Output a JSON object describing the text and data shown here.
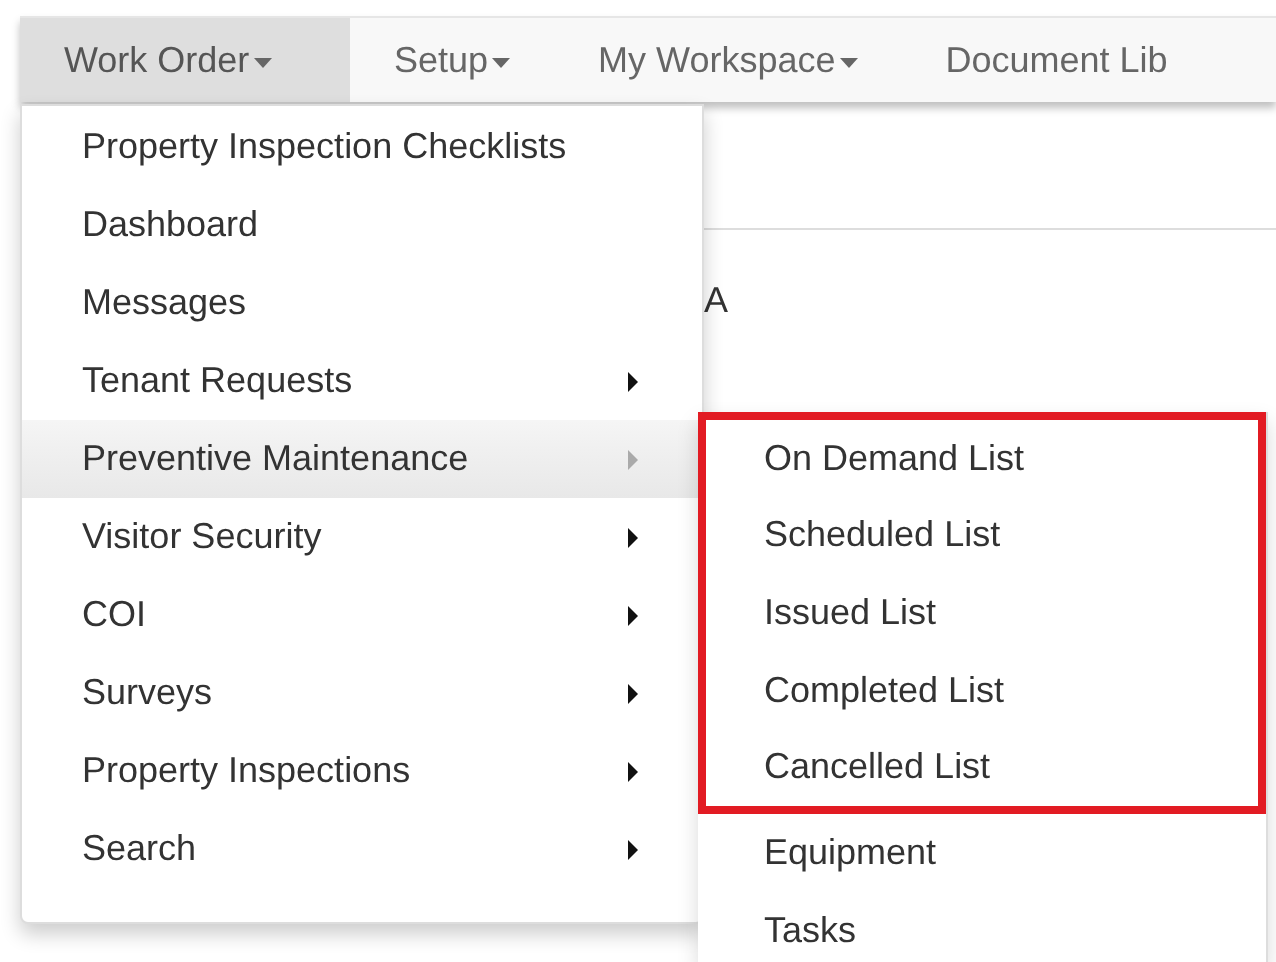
{
  "navbar": {
    "tabs": [
      {
        "label": "Work Order",
        "selected": true,
        "dropdown": true
      },
      {
        "label": "Setup",
        "selected": false,
        "dropdown": true
      },
      {
        "label": "My Workspace",
        "selected": false,
        "dropdown": true
      },
      {
        "label": "Document Lib",
        "selected": false,
        "dropdown": false
      }
    ]
  },
  "background_text": [
    "A"
  ],
  "menu": {
    "items": [
      {
        "label": "Property Inspection Checklists",
        "has_submenu": false,
        "selected": false
      },
      {
        "label": "Dashboard",
        "has_submenu": false,
        "selected": false
      },
      {
        "label": "Messages",
        "has_submenu": false,
        "selected": false
      },
      {
        "label": "Tenant Requests",
        "has_submenu": true,
        "selected": false
      },
      {
        "label": "Preventive Maintenance",
        "has_submenu": true,
        "selected": true
      },
      {
        "label": "Visitor Security",
        "has_submenu": true,
        "selected": false
      },
      {
        "label": "COI",
        "has_submenu": true,
        "selected": false
      },
      {
        "label": "Surveys",
        "has_submenu": true,
        "selected": false
      },
      {
        "label": "Property Inspections",
        "has_submenu": true,
        "selected": false
      },
      {
        "label": "Search",
        "has_submenu": true,
        "selected": false
      }
    ]
  },
  "submenu": {
    "items": [
      {
        "label": "On Demand List",
        "boxed": true
      },
      {
        "label": "Scheduled List",
        "boxed": true
      },
      {
        "label": "Issued List",
        "boxed": true
      },
      {
        "label": "Completed List",
        "boxed": true
      },
      {
        "label": "Cancelled List",
        "boxed": true
      },
      {
        "label": "Equipment",
        "boxed": false
      },
      {
        "label": "Tasks",
        "boxed": false
      }
    ]
  }
}
